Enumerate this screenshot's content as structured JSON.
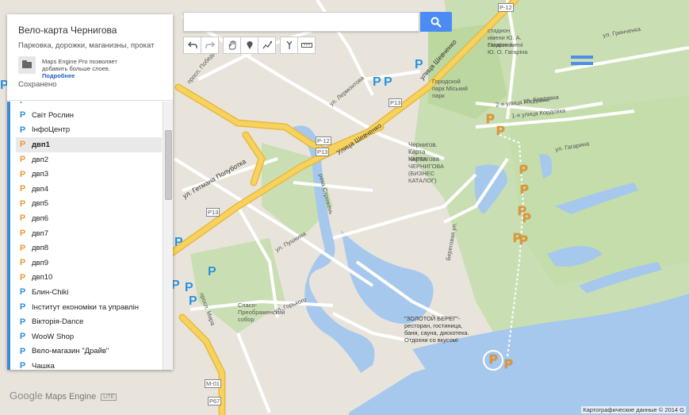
{
  "panel": {
    "title": "Вело-карта Чернигова",
    "description": "Парковка, дорожки, маганизны, прокат",
    "promo_text": "Maps Engine Pro позволяет добавить больше слоев.",
    "promo_link": "Подробнее",
    "saved": "Сохранено"
  },
  "list_items": [
    {
      "label": "Світ Рослин",
      "color": "blue"
    },
    {
      "label": "ІнфоЦентр",
      "color": "blue"
    },
    {
      "label": "двп1",
      "color": "orange",
      "selected": true
    },
    {
      "label": "двп2",
      "color": "orange"
    },
    {
      "label": "двп3",
      "color": "orange"
    },
    {
      "label": "двп4",
      "color": "orange"
    },
    {
      "label": "двп5",
      "color": "orange"
    },
    {
      "label": "двп6",
      "color": "orange"
    },
    {
      "label": "двп7",
      "color": "orange"
    },
    {
      "label": "двп8",
      "color": "orange"
    },
    {
      "label": "двп9",
      "color": "orange"
    },
    {
      "label": "двп10",
      "color": "orange"
    },
    {
      "label": "Блин-Chiki",
      "color": "blue"
    },
    {
      "label": "Інститут економіки та управлін",
      "color": "blue"
    },
    {
      "label": "Вікторія-Dance",
      "color": "blue"
    },
    {
      "label": "WooW Shop",
      "color": "blue"
    },
    {
      "label": "Вело-магазин \"Драйв\"",
      "color": "blue"
    },
    {
      "label": "Чашка",
      "color": "blue"
    }
  ],
  "search": {
    "placeholder": ""
  },
  "map_labels": {
    "shevchenko_1": "улица Шевченко",
    "shevchenko_2": "Улица Шевченко",
    "getmana": "ул. Гетмана Полуботка",
    "pobedy": "просп. Победы",
    "mira": "просп. Мира",
    "park": "Городской парк Міський парк",
    "chernigov": "Чернигов. Карта Чернигова",
    "karta": "КАРТА ЧЕРНИГОВА (БИЗНЕС КАТАЛОГ)",
    "stadium": "стадион имени Ю. А. Гагарина",
    "stadium2": "стадіон імені Ю. О. Гагаріна",
    "kordovka1": "1-я улица Кордовка",
    "kordovka2": "2-я улица Кордовка",
    "strizhen": "река Стрижень",
    "sobor": "Спасо-Преображенский собор",
    "zoloty": "\"ЗОЛОТОЙ БЕРЕГ\"-ресторан, гостиница, баня, сауна, дискотека. Отдохни со вкусом!",
    "beregovaya": "Береговая ул.",
    "r12a": "Р-12",
    "r12b": "Р-12",
    "p13a": "Р13",
    "p13b": "Р13",
    "p13c": "Р13",
    "m01": "М-01",
    "p67": "Р67",
    "gorkogo": "ул. Горького",
    "pushkina": "ул. Пушкина",
    "lermontova": "ул. Лермонтова",
    "grinchenka": "ул. Гринченка",
    "kordovka_u": "ул. Кордовка",
    "gagarina": "ул. Гагарина"
  },
  "logo": {
    "google": "Google",
    "product": "Maps Engine",
    "badge": "LITE"
  },
  "copyright": "Картографические данные © 2014 G",
  "colors": {
    "accent": "#4b8bf4",
    "marker_blue": "#2b8fd8",
    "marker_orange": "#e8952f",
    "road_yellow": "#f6d25e"
  }
}
